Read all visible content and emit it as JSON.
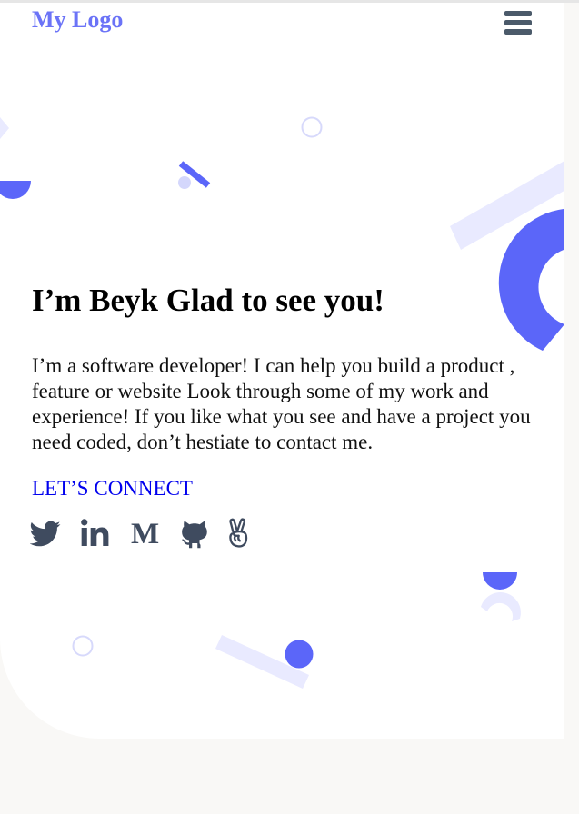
{
  "header": {
    "logo_text": "My Logo",
    "menu_icon": "hamburger-menu-icon"
  },
  "hero": {
    "heading": "I’m Beyk Glad to see you!",
    "bio": "I’m a software developer! I can help you build a product , feature or website Look through some of my work and experience! If you like what you see and have a project you need coded, don’t hestiate to contact me.",
    "cta_label": "LET’S CONNECT"
  },
  "socials": [
    {
      "icon": "twitter-icon"
    },
    {
      "icon": "linkedin-icon"
    },
    {
      "icon": "medium-icon",
      "glyph": "M"
    },
    {
      "icon": "github-icon"
    },
    {
      "icon": "angellist-icon"
    }
  ],
  "colors": {
    "accent": "#6b73f7",
    "shape_blue": "#5b66f9",
    "shape_light": "#e9eaff",
    "icon_gray": "#3f4b5f",
    "link": "#0000ee"
  }
}
